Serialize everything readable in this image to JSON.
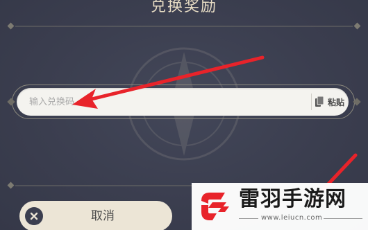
{
  "dialog": {
    "title": "兑换奖励"
  },
  "redeem": {
    "placeholder": "输入兑换码",
    "value": "",
    "paste_label": "粘贴"
  },
  "actions": {
    "cancel_label": "取消"
  },
  "watermark": {
    "name": "雷羽手游网",
    "url": "www.leiucn.com"
  },
  "colors": {
    "background": "#3b3e4f",
    "title_text": "#e7dcc4",
    "input_bg": "#f4f3ef",
    "cancel_bg": "#ece5d6",
    "arrow": "#e8232a",
    "logo_red": "#e8232a"
  },
  "icons": {
    "paste": "clipboard-icon",
    "cancel": "close-icon"
  }
}
